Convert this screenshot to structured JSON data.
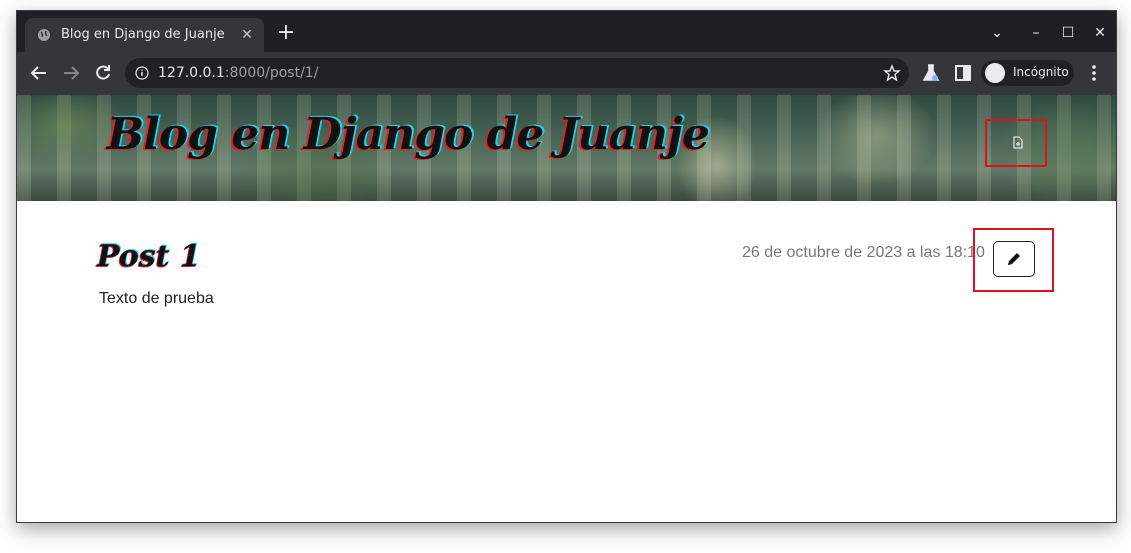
{
  "browser": {
    "tab_title": "Blog en Django de Juanje",
    "tab_close": "✕",
    "new_tab": "+",
    "url_host": "127.0.0.1",
    "url_path": ":8000/post/1/",
    "incognito_label": "Incógnito",
    "window_controls": {
      "minimize": "–",
      "maximize": "☐",
      "close": "✕",
      "tab_search": "⌄"
    }
  },
  "site": {
    "title": "Blog en Django de Juanje"
  },
  "post": {
    "title": "Post 1",
    "date": "26 de octubre de 2023 a las 18:10",
    "body": "Texto de prueba"
  },
  "colors": {
    "highlight_border": "#e01020",
    "tabstrip": "#1f2023",
    "toolbar": "#35363a"
  }
}
